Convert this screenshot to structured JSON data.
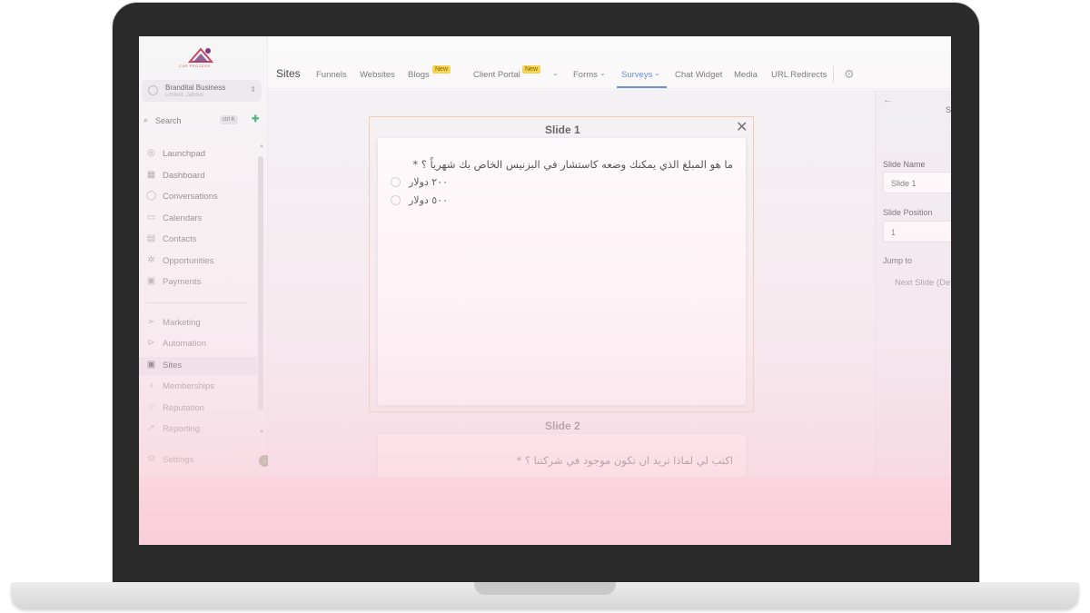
{
  "sidebar": {
    "logo_text": "CAR PROCESS",
    "account": {
      "name": "Brandital Business",
      "sub": "Limited, Jabdori"
    },
    "search": {
      "label": "Search",
      "shortcut": "ctrl K"
    },
    "items": [
      {
        "label": "Launchpad",
        "icon": "rocket-icon"
      },
      {
        "label": "Dashboard",
        "icon": "grid-icon"
      },
      {
        "label": "Conversations",
        "icon": "chat-icon"
      },
      {
        "label": "Calendars",
        "icon": "calendar-icon"
      },
      {
        "label": "Contacts",
        "icon": "contacts-icon"
      },
      {
        "label": "Opportunities",
        "icon": "opportunities-icon"
      },
      {
        "label": "Payments",
        "icon": "payments-icon"
      },
      {
        "label": "Marketing",
        "icon": "send-icon"
      },
      {
        "label": "Automation",
        "icon": "automation-icon"
      },
      {
        "label": "Sites",
        "icon": "sites-icon"
      },
      {
        "label": "Memberships",
        "icon": "membership-icon"
      },
      {
        "label": "Reputation",
        "icon": "star-icon"
      },
      {
        "label": "Reporting",
        "icon": "trend-icon"
      }
    ],
    "settings_label": "Settings"
  },
  "topnav": {
    "title": "Sites",
    "tabs": [
      {
        "label": "Funnels"
      },
      {
        "label": "Websites"
      },
      {
        "label": "Blogs",
        "badge": "New"
      },
      {
        "label": "Client Portal",
        "badge": "New"
      },
      {
        "label": "Forms"
      },
      {
        "label": "Surveys",
        "active": true
      },
      {
        "label": "Chat Widget"
      },
      {
        "label": "Media"
      },
      {
        "label": "URL Redirects"
      }
    ]
  },
  "slides": [
    {
      "title": "Slide 1",
      "question": "ما هو المبلغ الذي يمكنك وضعه كاستشار في البزنيس الخاص بك شهرياً ؟ *",
      "options": [
        "٢٠٠ دولار",
        "٥٠٠ دولار"
      ]
    },
    {
      "title": "Slide 2",
      "question": "اكتب لي لماذا تريد ان تكون موجود في شركتنا ؟ *"
    }
  ],
  "panel": {
    "heading_fragment": "S",
    "slide_name_label": "Slide Name",
    "slide_name_value": "Slide 1",
    "slide_position_label": "Slide Position",
    "slide_position_value": "1",
    "jump_to_label": "Jump to",
    "jump_to_value": "Next Slide (Default)"
  }
}
